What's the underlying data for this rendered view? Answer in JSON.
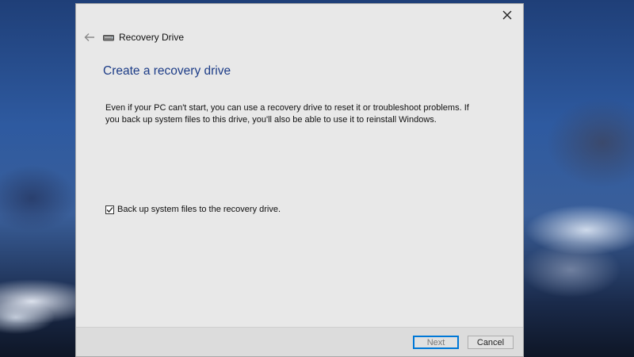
{
  "window": {
    "title": "Recovery Drive",
    "close_icon": "close-icon",
    "back_icon": "back-arrow-icon",
    "drive_icon": "drive-icon"
  },
  "main": {
    "heading": "Create a recovery drive",
    "description_line1": "Even if your PC can't start, you can use a recovery drive to reset it or troubleshoot problems. If",
    "description_line2": "you back up system files to this drive, you'll also be able to use it to reinstall Windows.",
    "backup_checkbox": {
      "label": "Back up system files to the recovery drive.",
      "checked": true
    }
  },
  "footer": {
    "next_label": "Next",
    "cancel_label": "Cancel"
  },
  "colors": {
    "heading": "#1c3c87",
    "focus_border": "#0078d7",
    "window_bg": "#e8e8e8"
  }
}
